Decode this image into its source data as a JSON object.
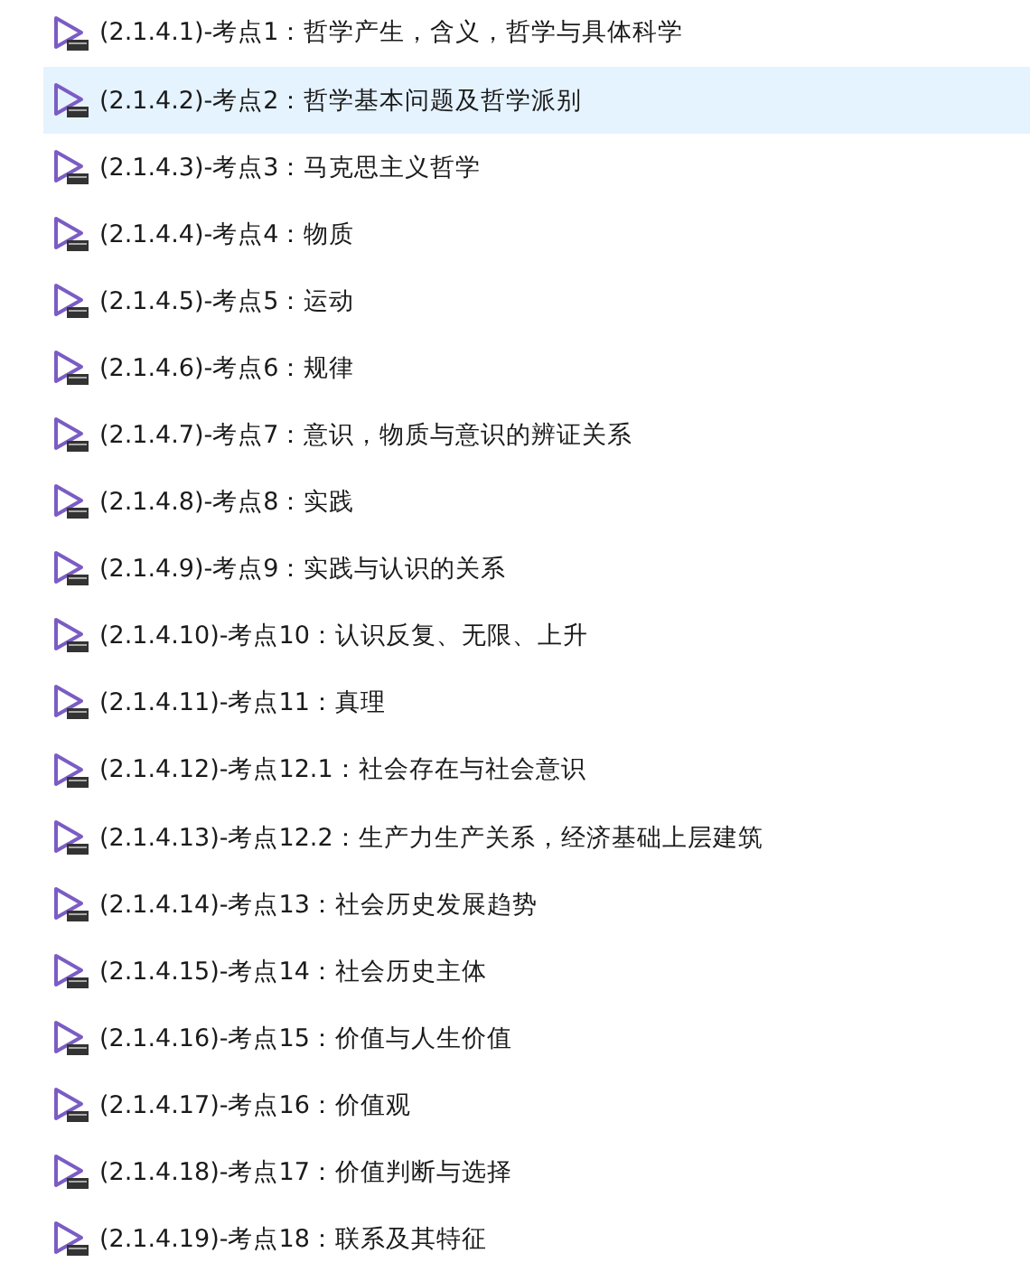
{
  "files": [
    {
      "name": "(2.1.4.1)-考点1：哲学产生，含义，哲学与具体科学",
      "selected": false
    },
    {
      "name": "(2.1.4.2)-考点2：哲学基本问题及哲学派别",
      "selected": true
    },
    {
      "name": "(2.1.4.3)-考点3：马克思主义哲学",
      "selected": false
    },
    {
      "name": "(2.1.4.4)-考点4：物质",
      "selected": false
    },
    {
      "name": "(2.1.4.5)-考点5：运动",
      "selected": false
    },
    {
      "name": "(2.1.4.6)-考点6：规律",
      "selected": false
    },
    {
      "name": "(2.1.4.7)-考点7：意识，物质与意识的辨证关系",
      "selected": false
    },
    {
      "name": "(2.1.4.8)-考点8：实践",
      "selected": false
    },
    {
      "name": "(2.1.4.9)-考点9：实践与认识的关系",
      "selected": false
    },
    {
      "name": "(2.1.4.10)-考点10：认识反复、无限、上升",
      "selected": false
    },
    {
      "name": "(2.1.4.11)-考点11：真理",
      "selected": false
    },
    {
      "name": "(2.1.4.12)-考点12.1：社会存在与社会意识",
      "selected": false
    },
    {
      "name": "(2.1.4.13)-考点12.2：生产力生产关系，经济基础上层建筑",
      "selected": false
    },
    {
      "name": "(2.1.4.14)-考点13：社会历史发展趋势",
      "selected": false
    },
    {
      "name": "(2.1.4.15)-考点14：社会历史主体",
      "selected": false
    },
    {
      "name": "(2.1.4.16)-考点15：价值与人生价值",
      "selected": false
    },
    {
      "name": "(2.1.4.17)-考点16：价值观",
      "selected": false
    },
    {
      "name": "(2.1.4.18)-考点17：价值判断与选择",
      "selected": false
    },
    {
      "name": "(2.1.4.19)-考点18：联系及其特征",
      "selected": false
    }
  ]
}
